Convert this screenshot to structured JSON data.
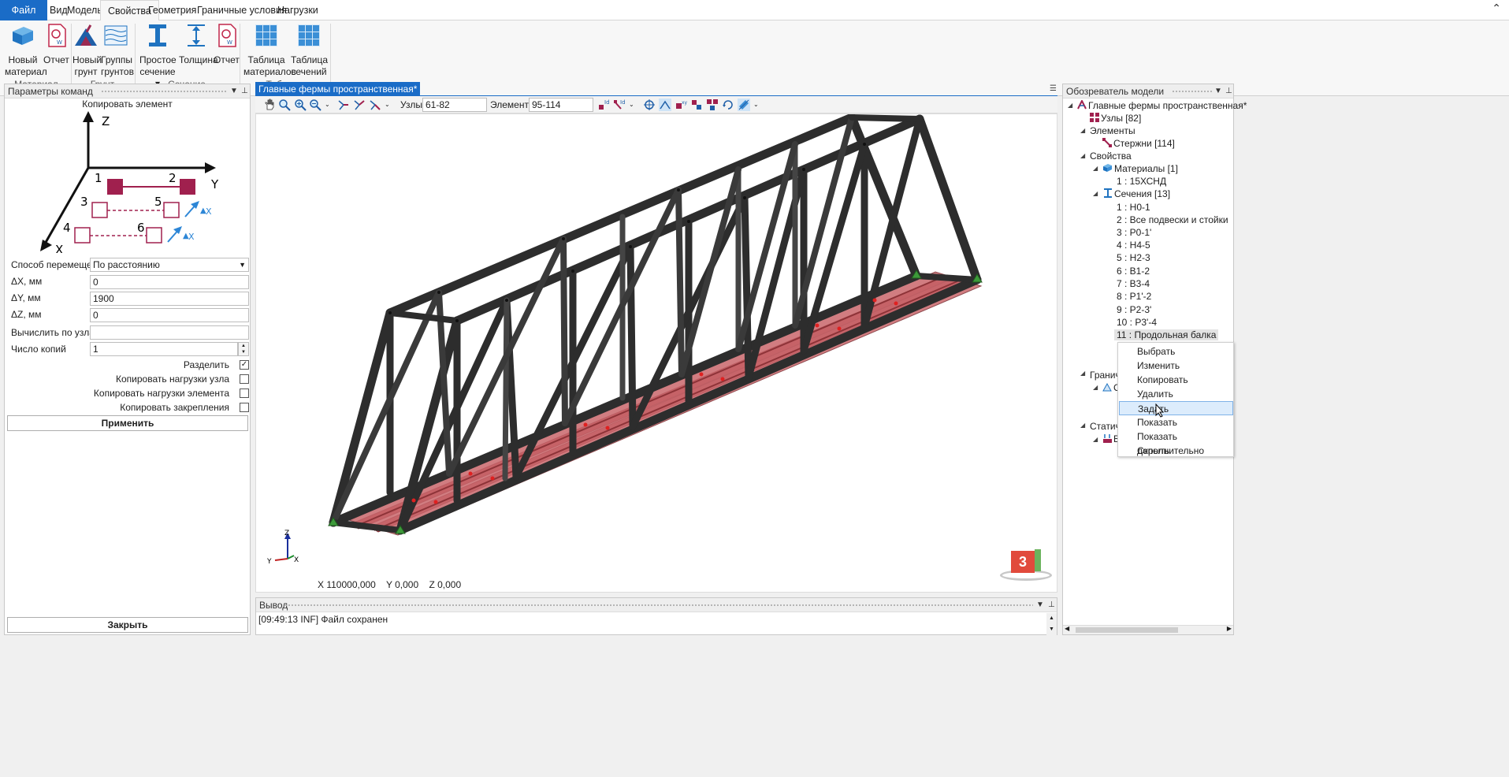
{
  "menu": {
    "file": "Файл",
    "tabs": [
      "Вид",
      "Модель",
      "Свойства",
      "Геометрия",
      "Граничные условия",
      "Нагрузки"
    ],
    "active": "Свойства"
  },
  "ribbon": {
    "buttons": [
      {
        "label1": "Новый",
        "label2": "материал",
        "icon": "new-material-icon"
      },
      {
        "label1": "Отчет",
        "label2": "",
        "icon": "report-icon"
      },
      {
        "label1": "Новый",
        "label2": "грунт",
        "icon": "new-soil-icon"
      },
      {
        "label1": "Группы",
        "label2": "грунтов",
        "icon": "soil-groups-icon"
      },
      {
        "label1": "Простое",
        "label2": "сечение ▾",
        "icon": "simple-section-icon"
      },
      {
        "label1": "Толщина",
        "label2": "",
        "icon": "thickness-icon"
      },
      {
        "label1": "Отчет",
        "label2": "",
        "icon": "report-icon"
      },
      {
        "label1": "Таблица",
        "label2": "материалов",
        "icon": "materials-table-icon"
      },
      {
        "label1": "Таблица",
        "label2": "сечений",
        "icon": "sections-table-icon"
      }
    ],
    "groups": [
      "Материал",
      "Грунт",
      "Сечение",
      "Таблицы"
    ]
  },
  "left_panel": {
    "title": "Параметры команд",
    "command": "Копировать элемент",
    "diagram": {
      "axis_z": "Z",
      "axis_y": "Y",
      "axis_x": "X",
      "n1": "1",
      "n2": "2",
      "n3": "3",
      "n4": "4",
      "n5": "5",
      "n6": "6",
      "dx_label": "X"
    },
    "move_method_label": "Способ перемещения",
    "move_method_value": "По расстоянию",
    "dx_label": "ΔX, мм",
    "dx_value": "0",
    "dy_label": "ΔY, мм",
    "dy_value": "1900",
    "dz_label": "ΔZ, мм",
    "dz_value": "0",
    "calc_nodes_label": "Вычислить по узлам",
    "calc_nodes_value": "",
    "copies_label": "Число копий",
    "copies_value": "1",
    "split_label": "Разделить",
    "split_checked": "✓",
    "copy_node_loads": "Копировать нагрузки узла",
    "copy_element_loads": "Копировать нагрузки элемента",
    "copy_supports": "Копировать закрепления",
    "apply": "Применить",
    "close": "Закрыть"
  },
  "viewport": {
    "tab": "Главные фермы пространственная*",
    "nodes_label": "Узлы",
    "nodes_value": "61-82",
    "elements_label": "Элементы",
    "elements_value": "95-114",
    "coords": "X 110000,000    Y 0,000    Z 0,000",
    "triad_z": "Z",
    "triad_y": "Y",
    "triad_x": "X",
    "cube_label": "3"
  },
  "output": {
    "title": "Вывод",
    "line": "[09:49:13 INF] Файл сохранен"
  },
  "explorer": {
    "title": "Обозреватель модели",
    "items": [
      {
        "text": "Главные фермы пространственная*"
      },
      {
        "text": "Узлы [82]"
      },
      {
        "text": "Элементы"
      },
      {
        "text": "Стержни [114]"
      },
      {
        "text": "Свойства"
      },
      {
        "text": "Материалы [1]"
      },
      {
        "text": "1 : 15ХСНД"
      },
      {
        "text": "Сечения [13]"
      },
      {
        "text": "1 : Н0-1"
      },
      {
        "text": "2 : Все подвески и стойки"
      },
      {
        "text": "3 : Р0-1'"
      },
      {
        "text": "4 : Н4-5"
      },
      {
        "text": "5 : Н2-3"
      },
      {
        "text": "6 : В1-2"
      },
      {
        "text": "7 : В3-4"
      },
      {
        "text": "8 : Р1'-2"
      },
      {
        "text": "9 : Р2-3'"
      },
      {
        "text": "10 : Р3'-4"
      },
      {
        "text": "11 : Продольная балка"
      },
      {
        "text": "Гранич"
      },
      {
        "text": "С"
      },
      {
        "text": "Статиче"
      },
      {
        "text": "В"
      }
    ],
    "context_menu": [
      "Выбрать",
      "Изменить",
      "Копировать",
      "Удалить",
      "Задать",
      "Показать",
      "Показать дополнительно",
      "Скрыть"
    ]
  },
  "colors": {
    "accent": "#1a6cc7",
    "truss": "#2d2d2d",
    "beam": "#b5484e",
    "support": "#3d9a3a"
  }
}
